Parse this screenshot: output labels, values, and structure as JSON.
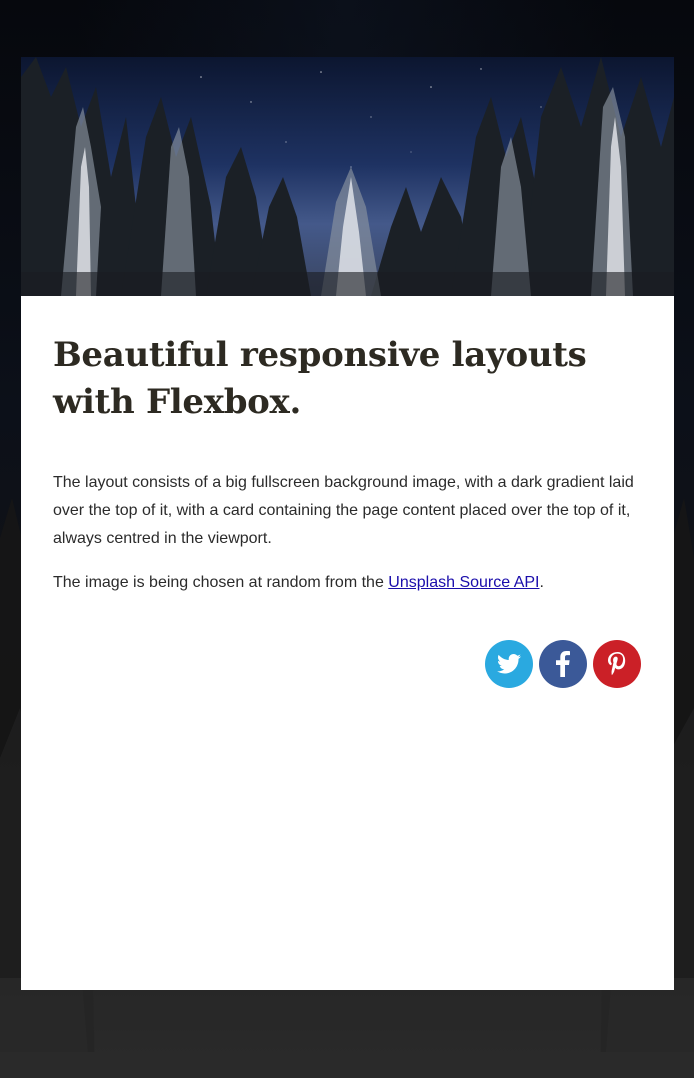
{
  "card": {
    "title": "Beautiful responsive layouts with Flexbox.",
    "paragraph_1": "The layout consists of a big fullscreen background image, with a dark gradient laid over the top of it, with a card containing the page content placed over the top of it, always centred in the viewport.",
    "paragraph_2_prefix": "The image is being chosen at random from the ",
    "paragraph_2_link": "Unsplash Source API",
    "paragraph_2_suffix": "."
  },
  "social": {
    "buttons": [
      {
        "icon": "twitter-icon",
        "color": "#2aa9e0"
      },
      {
        "icon": "facebook-icon",
        "color": "#3b5998"
      },
      {
        "icon": "pinterest-icon",
        "color": "#cb2027"
      }
    ]
  },
  "colors": {
    "title": "#2d2a22",
    "text": "#2b2b2b",
    "link": "#1a0dab",
    "card_background": "#ffffff",
    "page_background": "#0b0f16"
  }
}
